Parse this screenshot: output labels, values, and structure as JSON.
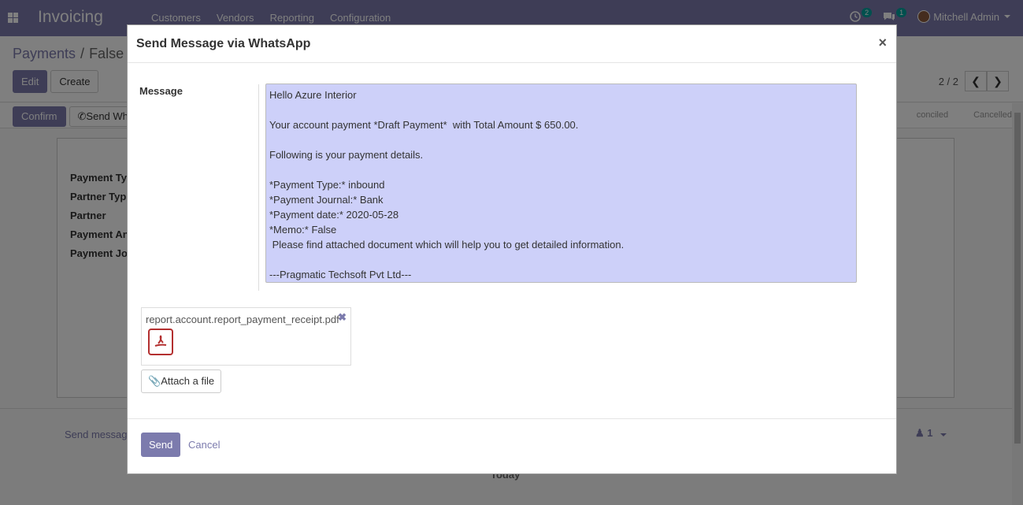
{
  "navbar": {
    "app_name": "Invoicing",
    "menu": [
      "Customers",
      "Vendors",
      "Reporting",
      "Configuration"
    ],
    "activity_count": "2",
    "message_count": "1",
    "user_name": "Mitchell Admin"
  },
  "control_panel": {
    "breadcrumb_parent": "Payments",
    "breadcrumb_current": "False",
    "edit_label": "Edit",
    "create_label": "Create",
    "pager_value": "2 / 2"
  },
  "statusbar": {
    "confirm_label": "Confirm",
    "send_whatsapp_label": "Send Whats",
    "stages": [
      "conciled",
      "Cancelled"
    ]
  },
  "form": {
    "labels": [
      "Payment Ty",
      "Partner Typ",
      "Partner",
      "Payment An",
      "Payment Jo"
    ]
  },
  "chatter": {
    "send_message": "Send messag",
    "followers": "1",
    "today": "Today"
  },
  "modal": {
    "title": "Send Message via WhatsApp",
    "close": "×",
    "message_label": "Message",
    "message": "Hello Azure Interior\n\nYour account payment *Draft Payment*  with Total Amount $ 650.00.\n\nFollowing is your payment details.\n\n*Payment Type:* inbound\n*Payment Journal:* Bank\n*Payment date:* 2020-05-28\n*Memo:* False\n Please find attached document which will help you to get detailed information.\n\n---Pragmatic Techsoft Pvt Ltd---",
    "attachment_name": "report.account.report_payment_receipt.pdf",
    "attach_label": "Attach a file",
    "send_label": "Send",
    "cancel_label": "Cancel"
  }
}
